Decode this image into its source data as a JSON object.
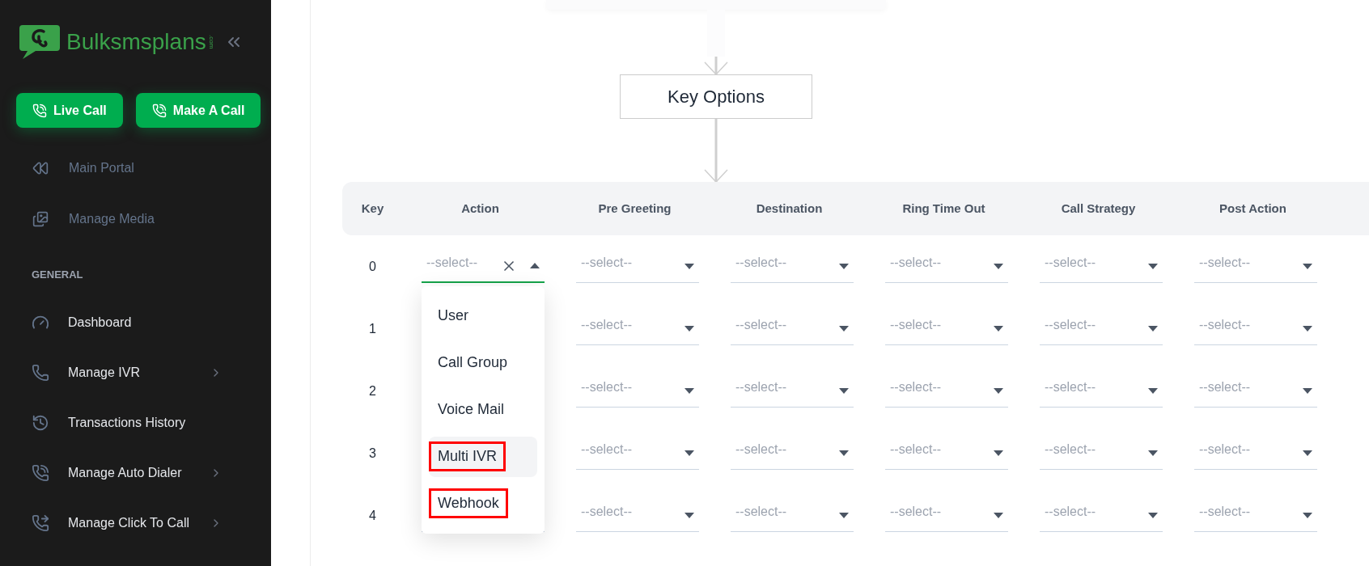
{
  "sidebar": {
    "logo": {
      "name": "Bulksmsplans",
      "suffix": ".com"
    },
    "buttons": [
      {
        "label": "Live Call"
      },
      {
        "label": "Make A Call"
      }
    ],
    "links": [
      {
        "label": "Main Portal"
      },
      {
        "label": "Manage Media"
      }
    ],
    "sections": [
      {
        "title": "GENERAL",
        "items": [
          {
            "label": "Dashboard",
            "expandable": false
          },
          {
            "label": "Manage IVR",
            "expandable": true
          },
          {
            "label": "Transactions History",
            "expandable": false
          },
          {
            "label": "Manage Auto Dialer",
            "expandable": true
          },
          {
            "label": "Manage Click To Call",
            "expandable": true
          }
        ]
      }
    ]
  },
  "flowchart": {
    "node": {
      "label": "Key Options"
    }
  },
  "table": {
    "columns": [
      "Key",
      "Action",
      "Pre Greeting",
      "Destination",
      "Ring Time Out",
      "Call Strategy",
      "Post Action"
    ],
    "rows": [
      {
        "key": "0",
        "selects": [
          {
            "placeholder": "--select--",
            "open": true,
            "options": [
              {
                "label": "User",
                "hovered": false,
                "highlighted": false
              },
              {
                "label": "Call Group",
                "hovered": false,
                "highlighted": false
              },
              {
                "label": "Voice Mail",
                "hovered": false,
                "highlighted": false
              },
              {
                "label": "Multi IVR",
                "hovered": true,
                "highlighted": true
              },
              {
                "label": "Webhook",
                "hovered": false,
                "highlighted": true
              }
            ]
          },
          {
            "placeholder": "--select--",
            "open": false
          },
          {
            "placeholder": "--select--",
            "open": false
          },
          {
            "placeholder": "--select--",
            "open": false
          },
          {
            "placeholder": "--select--",
            "open": false
          },
          {
            "placeholder": "--select--",
            "open": false
          }
        ]
      },
      {
        "key": "1",
        "selects": [
          {
            "placeholder": "--select--",
            "open": false
          },
          {
            "placeholder": "--select--",
            "open": false
          },
          {
            "placeholder": "--select--",
            "open": false
          },
          {
            "placeholder": "--select--",
            "open": false
          },
          {
            "placeholder": "--select--",
            "open": false
          }
        ]
      },
      {
        "key": "2",
        "selects": [
          {
            "placeholder": "--select--",
            "open": false
          },
          {
            "placeholder": "--select--",
            "open": false
          },
          {
            "placeholder": "--select--",
            "open": false
          },
          {
            "placeholder": "--select--",
            "open": false
          },
          {
            "placeholder": "--select--",
            "open": false
          }
        ]
      },
      {
        "key": "3",
        "selects": [
          {
            "placeholder": "--select--",
            "open": false
          },
          {
            "placeholder": "--select--",
            "open": false
          },
          {
            "placeholder": "--select--",
            "open": false
          },
          {
            "placeholder": "--select--",
            "open": false
          },
          {
            "placeholder": "--select--",
            "open": false
          }
        ]
      },
      {
        "key": "4",
        "selects": [
          {
            "placeholder": "--select--",
            "open": false
          },
          {
            "placeholder": "--select--",
            "open": false
          },
          {
            "placeholder": "--select--",
            "open": false
          },
          {
            "placeholder": "--select--",
            "open": false
          },
          {
            "placeholder": "--select--",
            "open": false
          }
        ]
      }
    ]
  }
}
